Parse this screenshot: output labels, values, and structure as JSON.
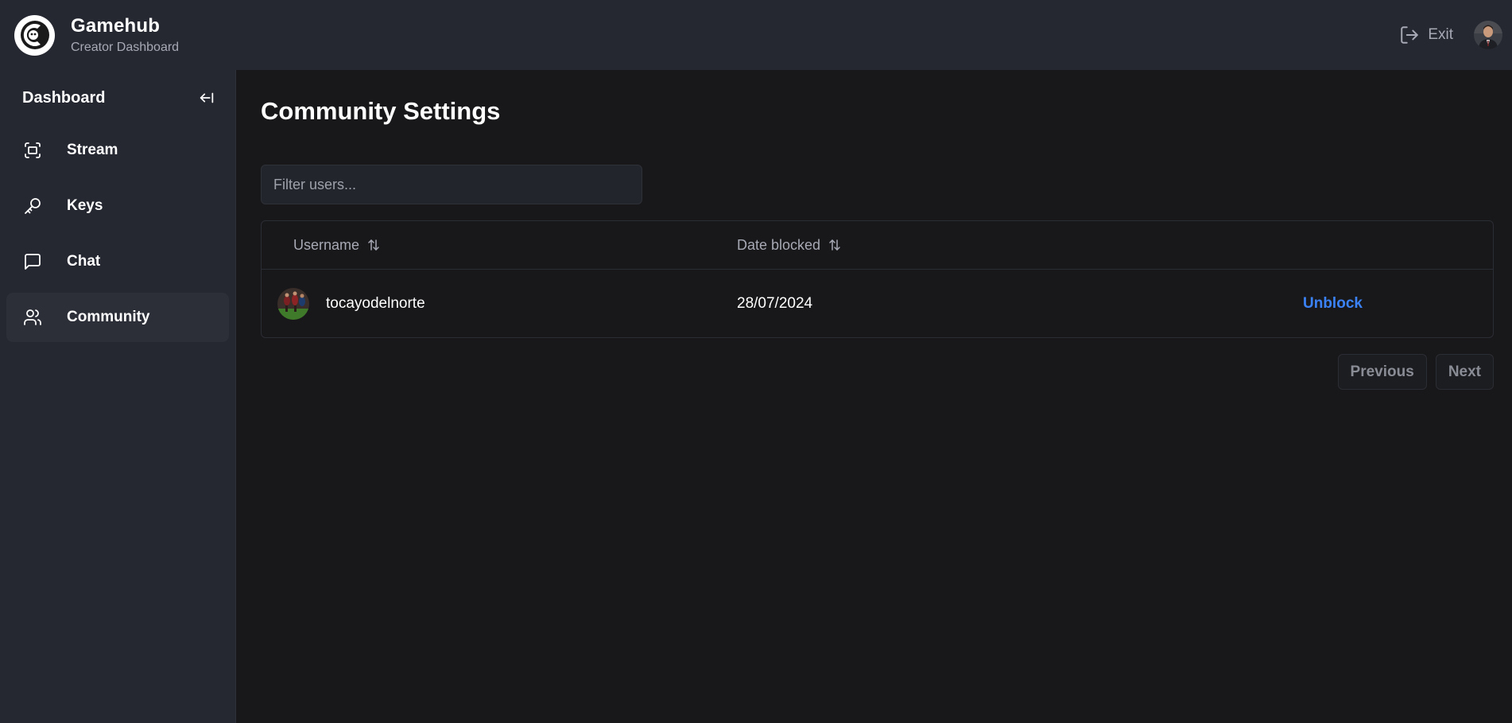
{
  "header": {
    "brand_title": "Gamehub",
    "brand_subtitle": "Creator Dashboard",
    "exit_label": "Exit"
  },
  "sidebar": {
    "title": "Dashboard",
    "items": [
      {
        "label": "Stream",
        "icon": "fullscreen-icon",
        "active": false
      },
      {
        "label": "Keys",
        "icon": "key-icon",
        "active": false
      },
      {
        "label": "Chat",
        "icon": "chat-bubble-icon",
        "active": false
      },
      {
        "label": "Community",
        "icon": "users-icon",
        "active": true
      }
    ]
  },
  "main": {
    "title": "Community Settings",
    "filter_placeholder": "Filter users...",
    "table": {
      "columns": [
        "Username",
        "Date blocked"
      ],
      "rows": [
        {
          "username": "tocayodelnorte",
          "date_blocked": "28/07/2024",
          "action": "Unblock"
        }
      ]
    },
    "pagination": {
      "previous": "Previous",
      "next": "Next"
    }
  },
  "colors": {
    "accent_link": "#3b82f6",
    "header_bg": "#252731",
    "content_bg": "#18181a"
  }
}
